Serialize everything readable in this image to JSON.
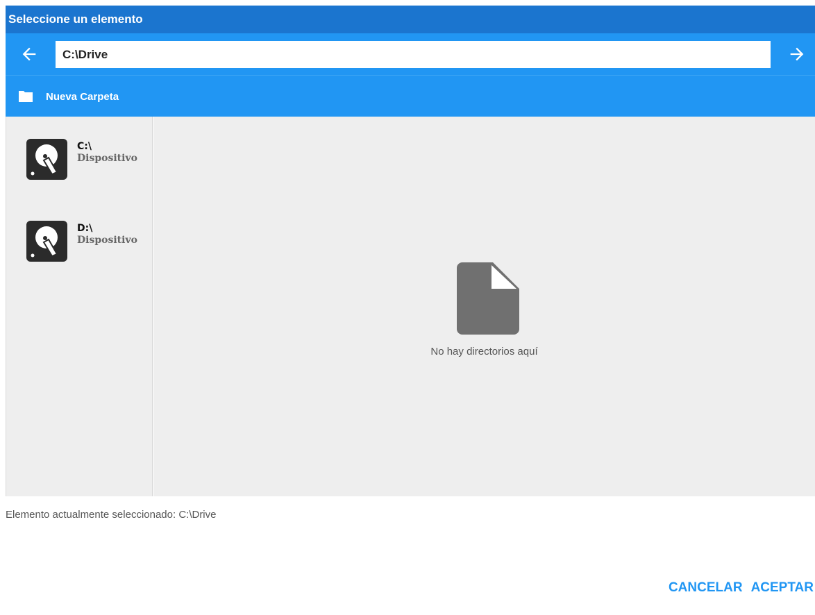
{
  "dialog": {
    "title": "Seleccione un elemento",
    "path_value": "C:\\Drive",
    "new_folder_label": "Nueva Carpeta",
    "drives": [
      {
        "name": "C:\\",
        "type": "Dispositivo"
      },
      {
        "name": "D:\\",
        "type": "Dispositivo"
      }
    ],
    "empty_message": "No hay directorios aquí",
    "status_text": "Elemento actualmente seleccionado: C:\\Drive",
    "cancel_label": "CANCELAR",
    "accept_label": "ACEPTAR"
  },
  "colors": {
    "title_bar": "#1b75cf",
    "toolbar": "#2196f3",
    "panel": "#eeeeee",
    "accent_text": "#2196f3"
  },
  "icons": {
    "back": "arrow-left-icon",
    "forward": "arrow-right-icon",
    "folder": "folder-icon",
    "drive": "hard-drive-icon",
    "empty": "file-icon"
  }
}
